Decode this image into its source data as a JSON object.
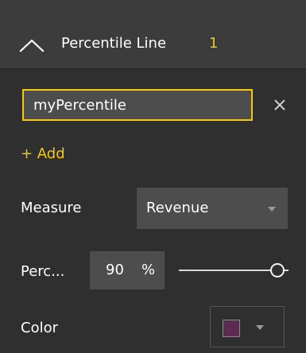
{
  "header": {
    "title": "Percentile Line",
    "count": "1",
    "collapse_icon": "chevron-up-icon"
  },
  "line_item": {
    "name_value": "myPercentile",
    "remove_icon": "close-icon"
  },
  "add": {
    "label": "+ Add",
    "icon": "plus-icon"
  },
  "measure": {
    "label": "Measure",
    "selected": "Revenue"
  },
  "percentile": {
    "label": "Perc...",
    "value": "90",
    "unit": "%",
    "slider_fraction": 0.9
  },
  "color": {
    "label": "Color",
    "swatch": "#5b2c4f"
  },
  "colors": {
    "accent": "#f2c811",
    "panel_bg": "#2f2f2f",
    "header_bg": "#3c3c3c",
    "field_bg": "#4d4d4d"
  }
}
